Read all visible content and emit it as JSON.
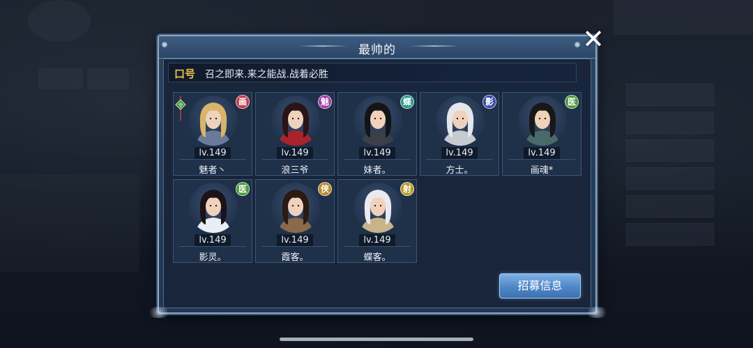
{
  "dialog": {
    "title": "最帅的",
    "close_label": "✕"
  },
  "slogan": {
    "label": "口号",
    "text": "召之即来.来之能战.战着必胜"
  },
  "members": [
    {
      "level": "lv.149",
      "name": "魅者丶",
      "badge": "画",
      "badge_color": "#c23a4a",
      "leader": true,
      "hair": "#d9b46a",
      "outfit": "#6a7a9a"
    },
    {
      "level": "lv.149",
      "name": "浪三爷",
      "badge": "魅",
      "badge_color": "#a23aa8",
      "leader": false,
      "hair": "#2a1418",
      "outfit": "#a8232c"
    },
    {
      "level": "lv.149",
      "name": "妹者。",
      "badge": "蝶",
      "badge_color": "#2a9a8a",
      "leader": false,
      "hair": "#141414",
      "outfit": "#3a3f4a"
    },
    {
      "level": "lv.149",
      "name": "方士。",
      "badge": "影",
      "badge_color": "#3a4aa8",
      "leader": false,
      "hair": "#e6e6ea",
      "outfit": "#c8cad2"
    },
    {
      "level": "lv.149",
      "name": "画魂*",
      "badge": "医",
      "badge_color": "#4a9a3a",
      "leader": false,
      "hair": "#181818",
      "outfit": "#4a6a6a"
    },
    {
      "level": "lv.149",
      "name": "影灵。",
      "badge": "医",
      "badge_color": "#4a9a3a",
      "leader": false,
      "hair": "#1c1218",
      "outfit": "#e8eef4"
    },
    {
      "level": "lv.149",
      "name": "霞客。",
      "badge": "侠",
      "badge_color": "#b88a2a",
      "leader": false,
      "hair": "#2a1a12",
      "outfit": "#8a6a4a"
    },
    {
      "level": "lv.149",
      "name": "蝶客。",
      "badge": "射",
      "badge_color": "#b89a2a",
      "leader": false,
      "hair": "#eaeaf0",
      "outfit": "#c9b48a"
    }
  ],
  "recruit_button": "招募信息"
}
